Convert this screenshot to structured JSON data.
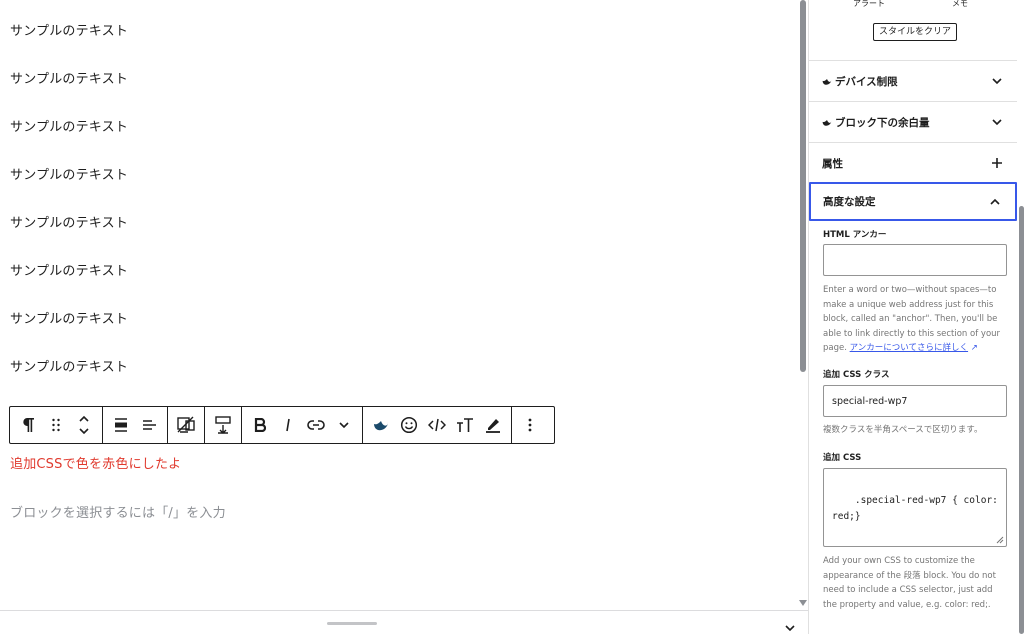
{
  "editor": {
    "paragraphs": [
      "サンプルのテキスト",
      "サンプルのテキスト",
      "サンプルのテキスト",
      "サンプルのテキスト",
      "サンプルのテキスト",
      "サンプルのテキスト",
      "サンプルのテキスト",
      "サンプルのテキスト"
    ],
    "selected_paragraph": "追加CSSで色を赤色にしたよ",
    "placeholder": "ブロックを選択するには「/」を入力",
    "selected_text_color": "#e03a2e"
  },
  "toolbar": {
    "icons": [
      "paragraph-icon",
      "drag-handle-icon",
      "move-up-down-icon",
      "align-center-icon",
      "align-left-icon",
      "device-icon",
      "margin-icon",
      "bold-icon",
      "italic-icon",
      "link-icon",
      "more-chevron-icon",
      "plugin-logo-icon",
      "emoji-icon",
      "code-icon",
      "text-size-icon",
      "highlight-icon",
      "options-icon"
    ]
  },
  "sidebar": {
    "style_labels": [
      "アラート",
      "メモ"
    ],
    "clear_style_label": "スタイルをクリア",
    "panels": {
      "device": "デバイス制限",
      "margin": "ブロック下の余白量",
      "attributes": "属性",
      "advanced": "高度な設定"
    },
    "html_anchor": {
      "label": "HTML アンカー",
      "value": "",
      "help": "Enter a word or two—without spaces—to make a unique web address just for this block, called an \"anchor\". Then, you'll be able to link directly to this section of your page.",
      "link": "アンカーについてさらに詳しく"
    },
    "css_class": {
      "label": "追加 CSS クラス",
      "value": "special-red-wp7",
      "help": "複数クラスを半角スペースで区切ります。"
    },
    "custom_css": {
      "label": "追加 CSS",
      "value": ".special-red-wp7 { color:\nred;}",
      "help": "Add your own CSS to customize the appearance of the 段落 block. You do not need to include a CSS selector, just add the property and value, e.g. color: red;."
    },
    "accent_color": "#3858e9"
  }
}
